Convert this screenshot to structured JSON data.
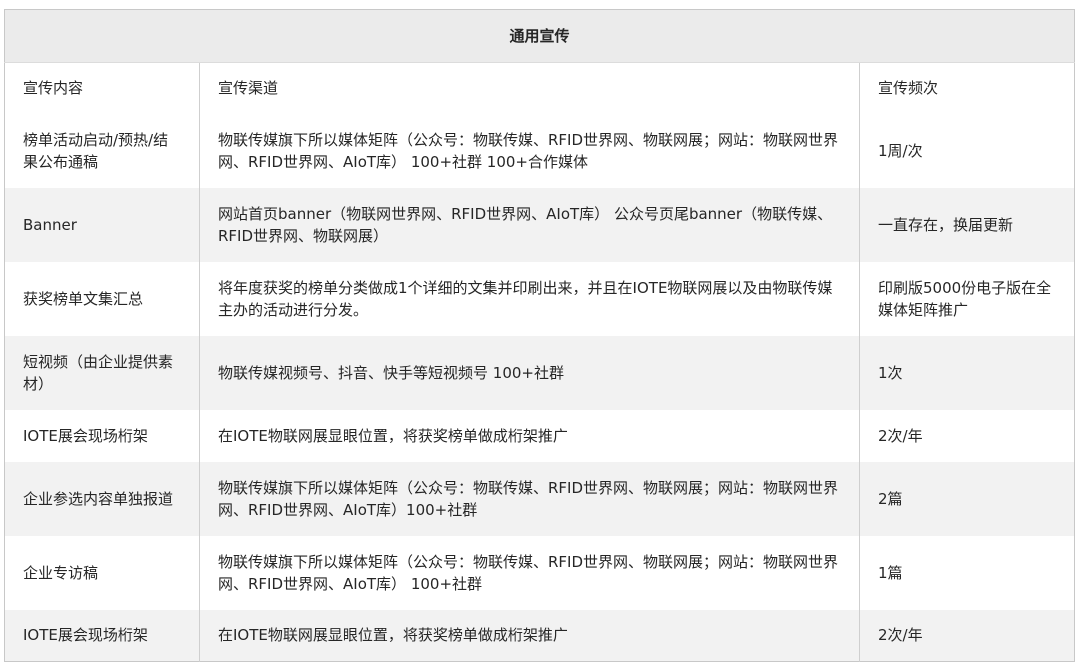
{
  "table": {
    "title": "通用宣传",
    "headers": [
      "宣传内容",
      "宣传渠道",
      "宣传频次"
    ],
    "rows": [
      [
        "宣传内容",
        "宣传渠道",
        "宣传频次"
      ],
      [
        "榜单活动启动/预热/结果公布通稿",
        "物联传媒旗下所以媒体矩阵（公众号：物联传媒、RFID世界网、物联网展；网站：物联网世界网、RFID世界网、AIoT库） 100+社群 100+合作媒体",
        "1周/次"
      ],
      [
        "Banner",
        "网站首页banner（物联网世界网、RFID世界网、AIoT库） 公众号页尾banner（物联传媒、RFID世界网、物联网展）",
        "一直存在，换届更新"
      ],
      [
        "获奖榜单文集汇总",
        "将年度获奖的榜单分类做成1个详细的文集并印刷出来，并且在IOTE物联网展以及由物联传媒主办的活动进行分发。",
        "印刷版5000份电子版在全媒体矩阵推广"
      ],
      [
        "短视频（由企业提供素材）",
        "物联传媒视频号、抖音、快手等短视频号 100+社群",
        "1次"
      ],
      [
        "IOTE展会现场桁架",
        "在IOTE物联网展显眼位置，将获奖榜单做成桁架推广",
        "2次/年"
      ],
      [
        "企业参选内容单独报道",
        "物联传媒旗下所以媒体矩阵（公众号：物联传媒、RFID世界网、物联网展；网站：物联网世界网、RFID世界网、AIoT库）100+社群",
        "2篇"
      ],
      [
        "企业专访稿",
        "物联传媒旗下所以媒体矩阵（公众号：物联传媒、RFID世界网、物联网展；网站：物联网世界网、RFID世界网、AIoT库） 100+社群",
        "1篇"
      ],
      [
        "IOTE展会现场桁架",
        "在IOTE物联网展显眼位置，将获奖榜单做成桁架推广",
        "2次/年"
      ]
    ]
  }
}
